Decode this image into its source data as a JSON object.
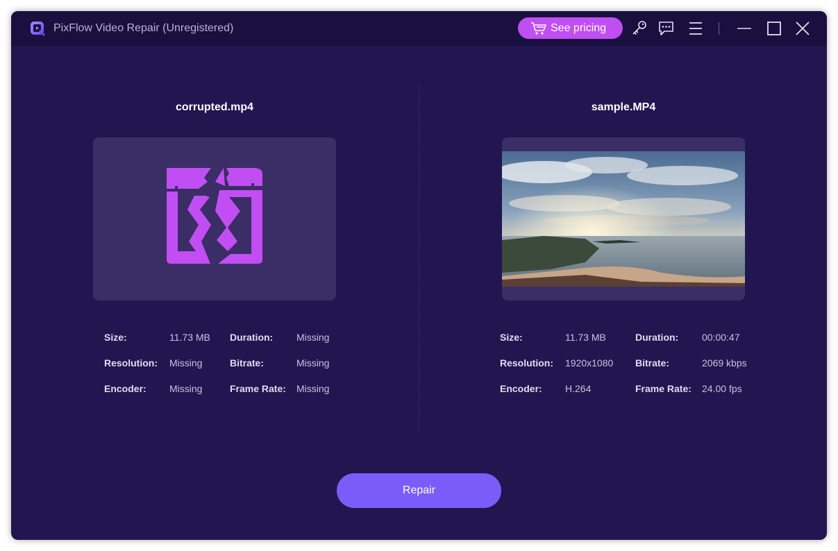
{
  "app": {
    "title": "PixFlow Video Repair (Unregistered)"
  },
  "titlebar": {
    "pricing_label": "See pricing",
    "icons": [
      "cart-icon",
      "key-icon",
      "feedback-icon",
      "menu-icon",
      "minimize-icon",
      "maximize-icon",
      "close-icon"
    ]
  },
  "colors": {
    "background": "#221650",
    "titlebar": "#1a1040",
    "accent": "#c14ef3",
    "primary_button": "#7b5cf8"
  },
  "left": {
    "file_name": "corrupted.mp4",
    "labels": {
      "size": "Size:",
      "resolution": "Resolution:",
      "encoder": "Encoder:",
      "duration": "Duration:",
      "bitrate": "Bitrate:",
      "frame_rate": "Frame Rate:"
    },
    "values": {
      "size": "11.73 MB",
      "resolution": "Missing",
      "encoder": "Missing",
      "duration": "Missing",
      "bitrate": "Missing",
      "frame_rate": "Missing"
    }
  },
  "right": {
    "file_name": "sample.MP4",
    "labels": {
      "size": "Size:",
      "resolution": "Resolution:",
      "encoder": "Encoder:",
      "duration": "Duration:",
      "bitrate": "Bitrate:",
      "frame_rate": "Frame Rate:"
    },
    "values": {
      "size": "11.73 MB",
      "resolution": "1920x1080",
      "encoder": "H.264",
      "duration": "00:00:47",
      "bitrate": "2069 kbps",
      "frame_rate": "24.00 fps"
    }
  },
  "actions": {
    "repair_label": "Repair"
  }
}
